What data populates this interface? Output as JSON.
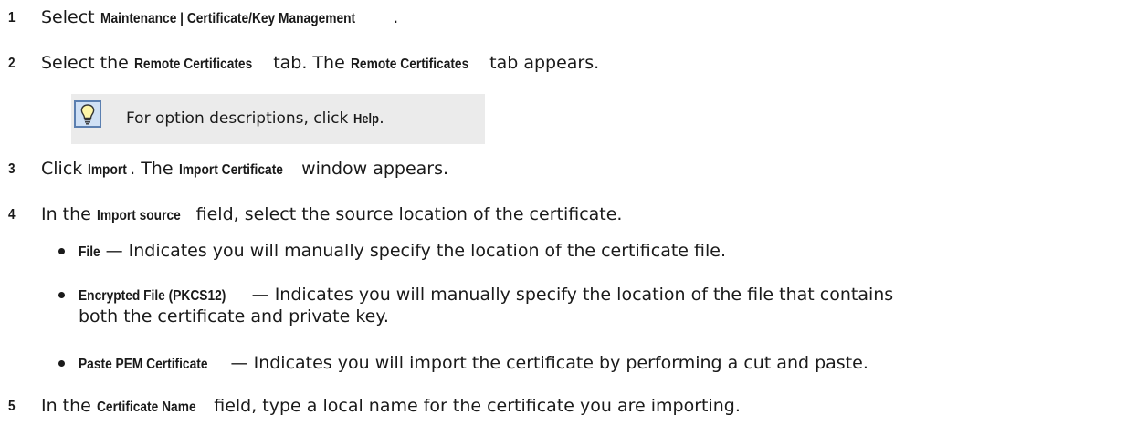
{
  "steps": [
    {
      "number": "1",
      "parts": [
        "Select ",
        "Maintenance | Certificate/Key Management",
        "."
      ]
    },
    {
      "number": "2",
      "parts": [
        "Select the ",
        "Remote Certificates",
        " tab. The ",
        "Remote Certificates",
        " tab appears."
      ]
    },
    {
      "number": "3",
      "parts": [
        "Click ",
        "Import",
        ". The ",
        "Import Certificate",
        " window appears."
      ]
    },
    {
      "number": "4",
      "parts": [
        "In the ",
        "Import source",
        " field, select the source location of the certificate."
      ]
    },
    {
      "number": "5",
      "parts": [
        "In the ",
        "Certificate Name",
        " field, type a local name for the certificate you are importing."
      ]
    }
  ],
  "tip": {
    "icon": "lightbulb-icon",
    "parts": [
      "For option descriptions, click ",
      "Help",
      "."
    ]
  },
  "options": [
    {
      "name": "File",
      "description": " — Indicates you will manually specify the location of the certificate file."
    },
    {
      "name": "Encrypted File (PKCS12)",
      "description": " — Indicates you will manually specify the location of the file that contains",
      "continuation": "both the certificate and private key."
    },
    {
      "name": "Paste PEM Certificate",
      "description": " — Indicates you will import the certificate by performing a cut and paste."
    }
  ],
  "colors": {
    "text": "#1a1a1a",
    "tip_background": "#ebebeb",
    "icon_border": "#5b7fb0",
    "icon_fill": "#cfe0f5",
    "bulb": "#fff6a8"
  }
}
